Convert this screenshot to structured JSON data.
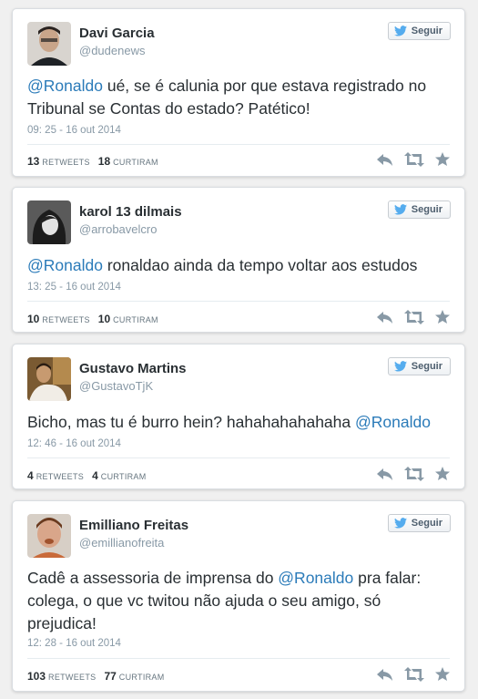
{
  "follow_label": "Seguir",
  "retweets_label": "RETWEETS",
  "likes_label": "CURTIRAM",
  "tweets": [
    {
      "name": "Davi Garcia",
      "handle": "@dudenews",
      "text_parts": [
        {
          "type": "mention",
          "value": "@Ronaldo"
        },
        {
          "type": "text",
          "value": " ué, se é calunia por que estava registrado no Tribunal se Contas do estado? Patético!"
        }
      ],
      "time": "09: 25 - 16 out 2014",
      "retweets": "13",
      "likes": "18"
    },
    {
      "name": "karol 13 dilmais",
      "handle": "@arrobavelcro",
      "text_parts": [
        {
          "type": "mention",
          "value": "@Ronaldo"
        },
        {
          "type": "text",
          "value": " ronaldao ainda da tempo voltar aos estudos"
        }
      ],
      "time": "13: 25 - 16 out 2014",
      "retweets": "10",
      "likes": "10"
    },
    {
      "name": "Gustavo Martins",
      "handle": "@GustavoTjK",
      "text_parts": [
        {
          "type": "text",
          "value": "Bicho, mas tu é burro hein? hahahahahahaha "
        },
        {
          "type": "mention",
          "value": "@Ronaldo"
        }
      ],
      "time": "12: 46 - 16 out 2014",
      "retweets": "4",
      "likes": "4"
    },
    {
      "name": "Emilliano Freitas",
      "handle": "@emillianofreita",
      "text_parts": [
        {
          "type": "text",
          "value": "Cadê a assessoria de imprensa do "
        },
        {
          "type": "mention",
          "value": "@Ronaldo"
        },
        {
          "type": "text",
          "value": " pra falar: colega, o que vc twitou não ajuda o seu amigo, só prejudica!"
        }
      ],
      "time": "12: 28 - 16 out 2014",
      "retweets": "103",
      "likes": "77"
    }
  ],
  "colors": {
    "mention": "#2b7bb9",
    "twitter_blue": "#55acee",
    "action_icon": "#8899a6"
  },
  "icons": [
    "twitter-bird-icon",
    "reply-icon",
    "retweet-icon",
    "favorite-icon"
  ]
}
